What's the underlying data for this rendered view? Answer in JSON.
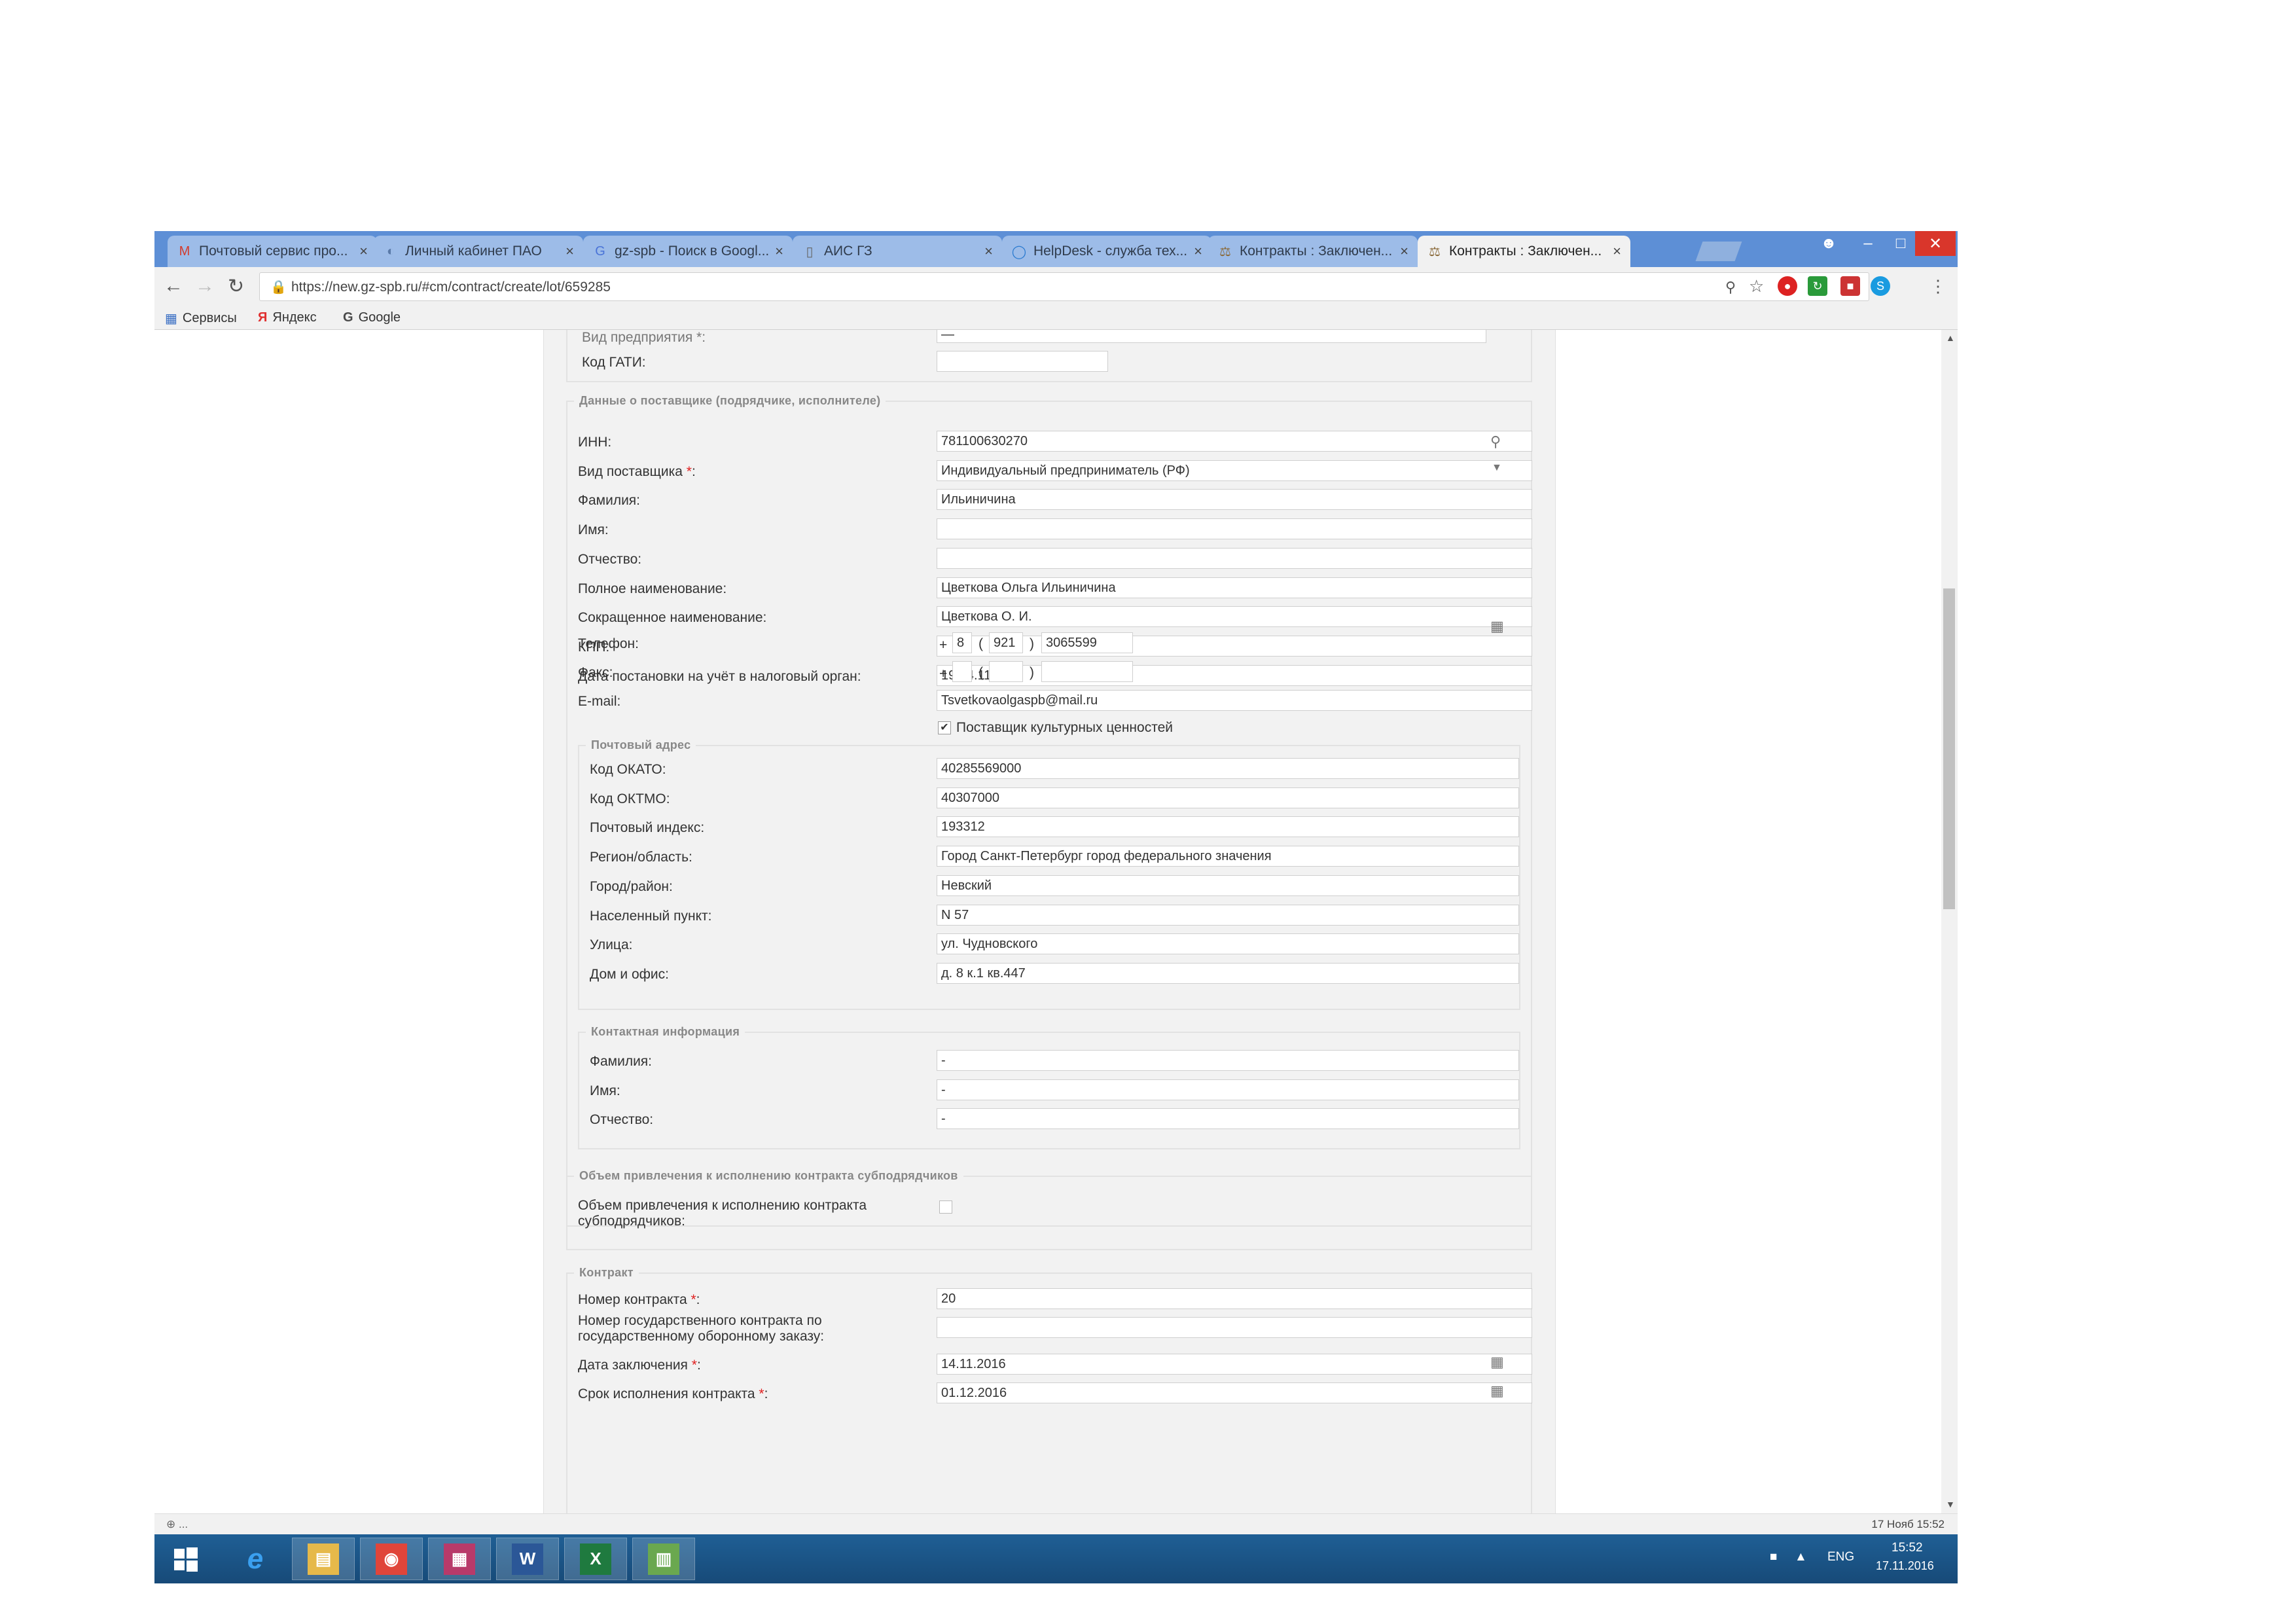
{
  "browser": {
    "tabs": [
      {
        "title": "Почтовый сервис про...",
        "icon": "gmail-icon"
      },
      {
        "title": "Личный кабинет ПАО",
        "icon": "page-icon"
      },
      {
        "title": "gz-spb - Поиск в Googl...",
        "icon": "google-icon"
      },
      {
        "title": "АИС ГЗ",
        "icon": "document-icon"
      },
      {
        "title": "HelpDesk - служба тех...",
        "icon": "helpdesk-icon"
      },
      {
        "title": "Контракты : Заключен...",
        "icon": "contract-icon"
      },
      {
        "title": "Контракты : Заключен...",
        "icon": "contract-icon"
      }
    ],
    "active_tab_index": 6,
    "tab_close_glyph": "×",
    "url": "https://new.gz-spb.ru/#cm/contract/create/lot/659285",
    "bookmarks": [
      {
        "label": "Сервисы",
        "icon": "apps-icon"
      },
      {
        "label": "Яндекс",
        "icon": "yandex-icon"
      },
      {
        "label": "Google",
        "icon": "google-icon"
      }
    ]
  },
  "form": {
    "top": {
      "partial_label": "Вид предприятия *:",
      "partial_value": "—",
      "gati_label": "Код ГАТИ:",
      "gati_value": ""
    },
    "supplier": {
      "legend": "Данные о поставщике (подрядчике, исполнителе)",
      "fields": [
        {
          "label": "ИНН:",
          "value": "781100630270"
        },
        {
          "label": "Вид поставщика",
          "required": true,
          "value": "Индивидуальный предприниматель (РФ)"
        },
        {
          "label": "Фамилия:",
          "value": "Ильиничина"
        },
        {
          "label": "Имя:",
          "value": ""
        },
        {
          "label": "Отчество:",
          "value": ""
        },
        {
          "label": "Полное наименование:",
          "value": "Цветкова Ольга Ильиничина"
        },
        {
          "label": "Сокращенное наименование:",
          "value": "Цветкова О. И."
        },
        {
          "label": "КПП:",
          "value": ""
        },
        {
          "label": "Дата постановки на учёт в налоговый орган:",
          "value": "19.04.11"
        }
      ],
      "phone": {
        "label": "Телефон:",
        "plus": "+",
        "country": "8",
        "open": "(",
        "code": "921",
        "close": ")",
        "number": "3065599"
      },
      "fax": {
        "label": "Факс:",
        "plus": "+",
        "country": "",
        "open": "(",
        "code": "",
        "close": ")",
        "number": ""
      },
      "email": {
        "label": "E-mail:",
        "value": "Tsvetkovaolgaspb@mail.ru"
      },
      "cultural_checkbox": {
        "label": "Поставщик культурных ценностей",
        "checked": true,
        "glyph": "✔"
      }
    },
    "postal": {
      "legend": "Почтовый адрес",
      "fields": [
        {
          "label": "Код ОКАТО:",
          "value": "40285569000"
        },
        {
          "label": "Код ОКТМО:",
          "value": "40307000"
        },
        {
          "label": "Почтовый индекс:",
          "value": "193312"
        },
        {
          "label": "Регион/область:",
          "value": "Город Санкт-Петербург город федерального значения"
        },
        {
          "label": "Город/район:",
          "value": "Невский"
        },
        {
          "label": "Населенный пункт:",
          "value": "N 57"
        },
        {
          "label": "Улица:",
          "value": "ул. Чудновского"
        },
        {
          "label": "Дом и офис:",
          "value": "д. 8 к.1 кв.447"
        }
      ]
    },
    "contact": {
      "legend": "Контактная информация",
      "fields": [
        {
          "label": "Фамилия:",
          "value": "-"
        },
        {
          "label": "Имя:",
          "value": "-"
        },
        {
          "label": "Отчество:",
          "value": "-"
        }
      ]
    },
    "subcontract": {
      "legend": "Объем привлечения к исполнению контракта субподрядчиков",
      "label": "Объем привлечения к исполнению контракта субподрядчиков:",
      "checked": false
    },
    "contract": {
      "legend": "Контракт",
      "fields": [
        {
          "label": "Номер контракта",
          "required": true,
          "value": "20"
        },
        {
          "label": "Номер государственного контракта по государственному оборонному заказу:",
          "value": ""
        },
        {
          "label": "Дата заключения",
          "required": true,
          "value": "14.11.2016"
        },
        {
          "label": "Срок исполнения контракта",
          "required": true,
          "value": "01.12.2016"
        }
      ]
    }
  },
  "statusbar": {
    "left": "⊕ ...",
    "right": "17 Нояб 15:52"
  },
  "taskbar": {
    "apps": [
      {
        "name": "internet-explorer-icon",
        "glyph": "e",
        "color": "#2a8fe0"
      },
      {
        "name": "file-explorer-icon",
        "glyph": "▤",
        "color": "#e6b94a"
      },
      {
        "name": "chrome-icon",
        "glyph": "◉",
        "color": "#e0453a"
      },
      {
        "name": "archiver-icon",
        "glyph": "▦",
        "color": "#b83a6a"
      },
      {
        "name": "word-icon",
        "glyph": "W",
        "color": "#2b5797"
      },
      {
        "name": "excel-icon",
        "glyph": "X",
        "color": "#1f7a3f"
      },
      {
        "name": "document-app-icon",
        "glyph": "▥",
        "color": "#6aa84f"
      }
    ],
    "lang": "ENG",
    "time": "15:52",
    "date": "17.11.2016"
  }
}
